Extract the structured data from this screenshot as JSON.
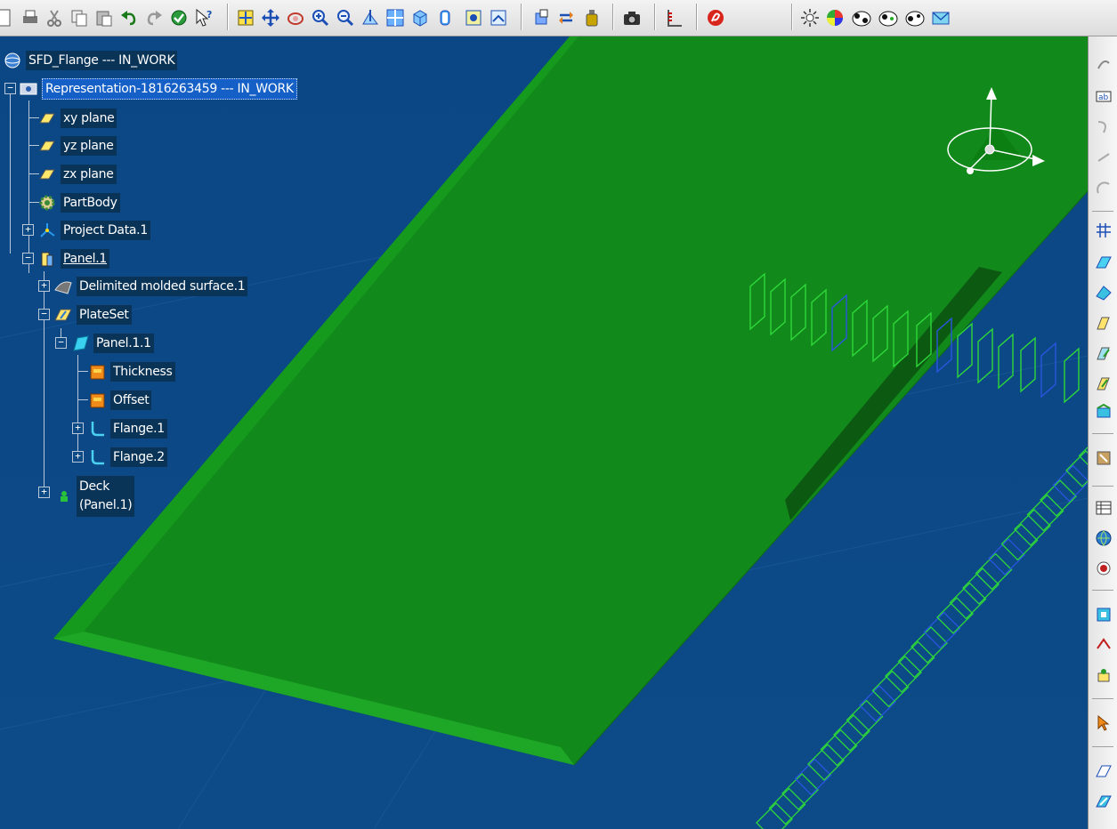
{
  "tree": {
    "root": "SFD_Flange --- IN_WORK",
    "representation": "Representation-1816263459 --- IN_WORK",
    "xy_plane": "xy plane",
    "yz_plane": "yz plane",
    "zx_plane": "zx plane",
    "partbody": "PartBody",
    "project_data": "Project Data.1",
    "panel": "Panel.1",
    "delimited_surface": "Delimited molded surface.1",
    "plateset": "PlateSet",
    "panel_1_1": "Panel.1.1",
    "thickness": "Thickness",
    "offset": "Offset",
    "flange1": "Flange.1",
    "flange2": "Flange.2",
    "deck_line1": "Deck",
    "deck_line2": "(Panel.1)",
    "expand_plus": "+",
    "collapse_minus": "−"
  },
  "colors": {
    "background": "#0d4a86",
    "panel_green": "#14891c",
    "selection_blue": "#1560c6"
  }
}
